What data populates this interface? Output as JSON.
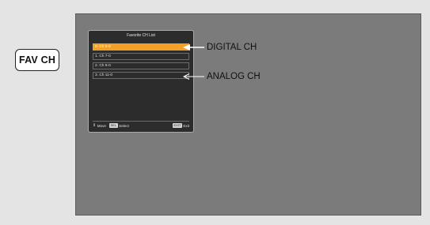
{
  "button": {
    "label": "FAV CH"
  },
  "menu": {
    "title": "Favorite CH List",
    "channels": [
      "0. Ch 5-0",
      "1. Ch 7-0",
      "2. Ch 9-0",
      "3. Ch 11-0"
    ],
    "selected_index": 0,
    "footer": {
      "move_icon": "up-down-arrows-icon",
      "move_label": "Move",
      "select_key": "SEL",
      "select_label": "Select",
      "exit_key": "EXIT",
      "exit_label": "Exit"
    }
  },
  "callouts": {
    "digital": "DIGITAL CH",
    "analog": "ANALOG CH"
  },
  "colors": {
    "highlight": "#f2a126",
    "screen": "#7b7b7b",
    "menu_bg": "#2c2c2c"
  }
}
